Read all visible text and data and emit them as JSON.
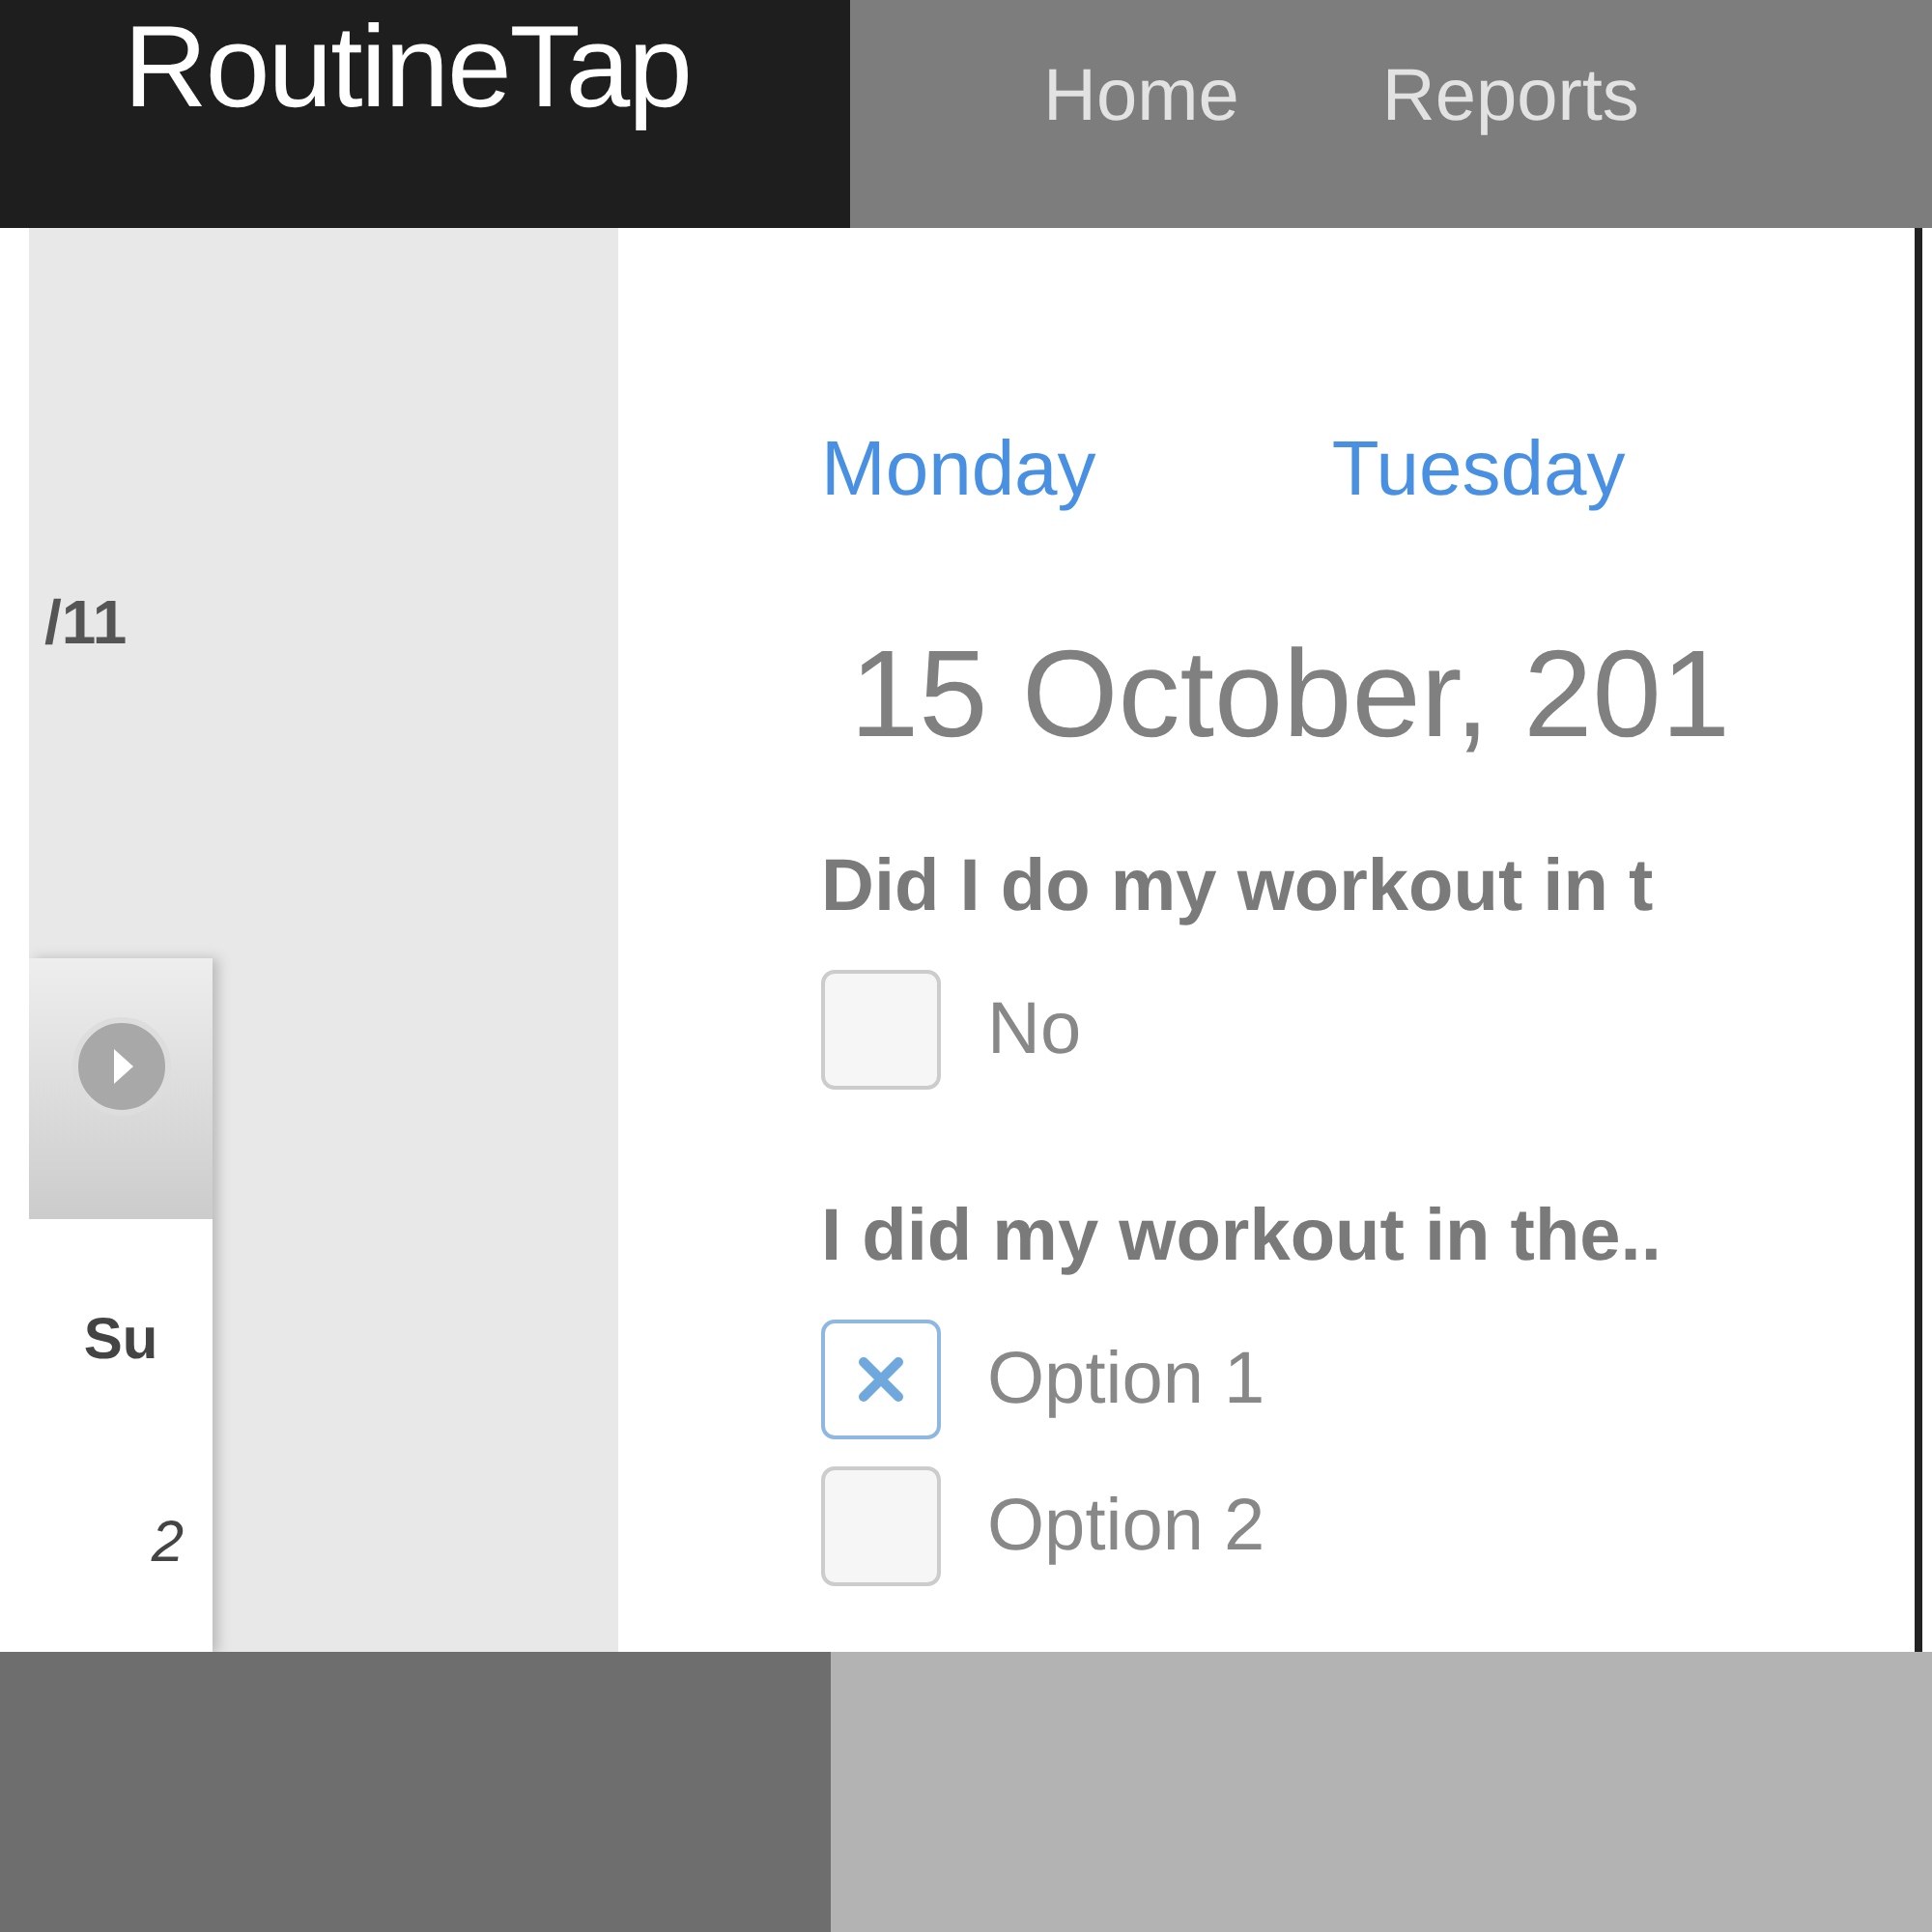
{
  "brand": "RoutineTap",
  "nav": [
    {
      "label": "Home",
      "selected": false
    },
    {
      "label": "Reports",
      "selected": false
    }
  ],
  "sidebar": {
    "date_range": "/11",
    "calendar": {
      "weekday": "Su",
      "day": "2"
    }
  },
  "day_tabs": [
    {
      "label": "Monday"
    },
    {
      "label": "Tuesday"
    }
  ],
  "date_heading": "15 October, 201",
  "questions": [
    {
      "text": "Did I do my workout in t",
      "options": [
        {
          "label": "No",
          "checked": false
        }
      ]
    },
    {
      "text": "I did my workout in the..",
      "options": [
        {
          "label": "Option 1",
          "checked": true
        },
        {
          "label": "Option 2",
          "checked": false
        }
      ]
    }
  ]
}
